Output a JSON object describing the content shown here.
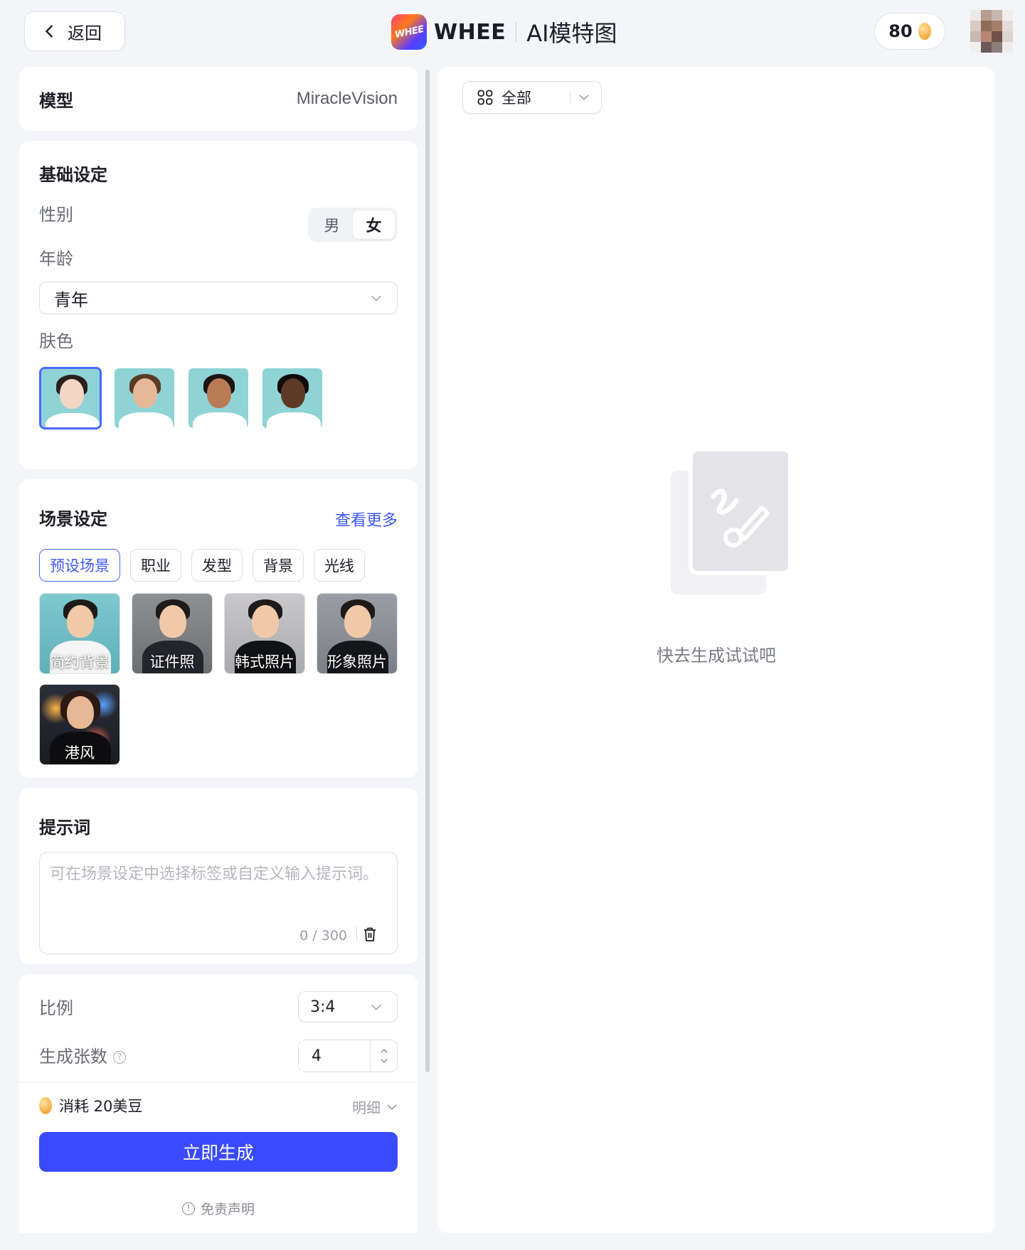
{
  "header": {
    "back_label": "返回",
    "logo_text": "WHEE",
    "brand_name": "WHEE",
    "page_title": "AI模特图",
    "credits": "80"
  },
  "model": {
    "label": "模型",
    "value": "MiracleVision"
  },
  "basic": {
    "title": "基础设定",
    "gender_label": "性别",
    "gender_options": [
      "男",
      "女"
    ],
    "gender_selected": "女",
    "age_label": "年龄",
    "age_value": "青年",
    "skin_label": "肤色",
    "skin_selected_index": 0
  },
  "scene": {
    "title": "场景设定",
    "more_label": "查看更多",
    "tabs": [
      "预设场景",
      "职业",
      "发型",
      "背景",
      "光线"
    ],
    "active_tab": "预设场景",
    "presets": [
      "简约背景",
      "证件照",
      "韩式照片",
      "形象照片",
      "港风"
    ]
  },
  "prompt": {
    "title": "提示词",
    "placeholder": "可在场景设定中选择标签或自定义输入提示词。",
    "counter": "0 / 300"
  },
  "settings": {
    "ratio_label": "比例",
    "ratio_value": "3:4",
    "count_label": "生成张数",
    "count_value": "4"
  },
  "footer": {
    "cost_label": "消耗 20美豆",
    "detail_label": "明细",
    "generate_label": "立即生成",
    "disclaimer_label": "免责声明"
  },
  "results": {
    "filter_label": "全部",
    "empty_text": "快去生成试试吧"
  },
  "colors": {
    "accent": "#3a4bff",
    "link": "#3e57ff",
    "background": "#f4f5f8"
  }
}
